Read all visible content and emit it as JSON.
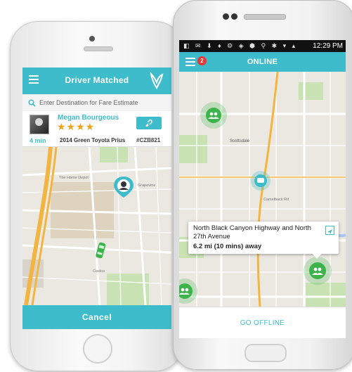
{
  "left_phone": {
    "header": {
      "title": "Driver Matched"
    },
    "search": {
      "placeholder": "Enter Destination for Fare Estimate"
    },
    "driver": {
      "name": "Megan Bourgeous",
      "stars": "★★★★",
      "eta": "4 min",
      "car": "2014 Green Toyota Prius",
      "plate": "#CZB821"
    },
    "map_labels": [
      "The Home Depot",
      "Grapevine",
      "Costco"
    ],
    "cancel_label": "Cancel"
  },
  "right_phone": {
    "status_bar": {
      "time": "12:29 PM"
    },
    "header": {
      "notification_count": "2",
      "status": "ONLINE"
    },
    "map_labels": [
      "Scottsdale",
      "Camelback Rd"
    ],
    "popup": {
      "address": "North Black Canyon Highway and North 27th Avenue",
      "distance": "6.2 mi (10 mins) away"
    },
    "offline_label": "GO OFFLINE"
  },
  "colors": {
    "accent": "#3ebccb",
    "star": "#f0a21b",
    "badge": "#e53935",
    "car_marker": "#3cb44b"
  }
}
